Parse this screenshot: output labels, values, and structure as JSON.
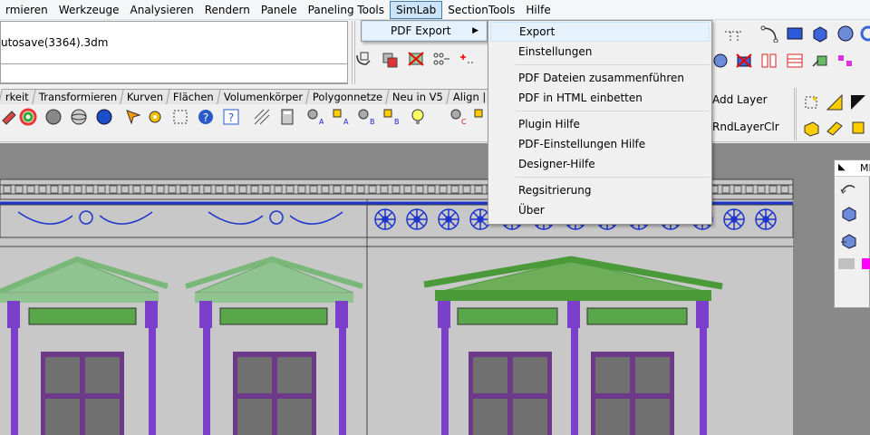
{
  "menubar": {
    "items": [
      "rmieren",
      "Werkzeuge",
      "Analysieren",
      "Rendern",
      "Panele",
      "Paneling Tools",
      "SimLab",
      "SectionTools",
      "Hilfe"
    ]
  },
  "command": {
    "history_text": "utosave(3364).3dm"
  },
  "tabs": [
    "rkeit",
    "Transformieren",
    "Kurven",
    "Flächen",
    "Volumenkörper",
    "Polygonnetze",
    "Neu in V5",
    "Align | Distrib"
  ],
  "toolbar_right": {
    "add_layer": "Add Layer",
    "rnd_layer_clr": "RndLayerClr"
  },
  "submenu_simlab": {
    "items": [
      {
        "label": "PDF Export",
        "has_submenu": true
      }
    ]
  },
  "submenu_pdf_export": {
    "items": [
      {
        "label": "Export",
        "highlighted": true
      },
      {
        "label": "Einstellungen"
      },
      {
        "sep": true
      },
      {
        "label": "PDF Dateien zusammenführen"
      },
      {
        "label": "PDF in HTML einbetten"
      },
      {
        "sep": true
      },
      {
        "label": "Plugin Hilfe"
      },
      {
        "label": "PDF-Einstellungen Hilfe"
      },
      {
        "label": "Designer-Hilfe"
      },
      {
        "sep": true
      },
      {
        "label": "Regsitrierung"
      },
      {
        "label": "Über"
      }
    ]
  },
  "float_panel": {
    "title": "MI"
  },
  "colors": {
    "viewport_bg": "#888888",
    "facade_bg": "#c8c8c8",
    "ornament_blue": "#1c33cc",
    "pediment_green": "#7ab87a",
    "pediment_green_dark": "#4a9a3a",
    "column_purple": "#7b3fc9",
    "window_purple": "#6d3a8a"
  }
}
